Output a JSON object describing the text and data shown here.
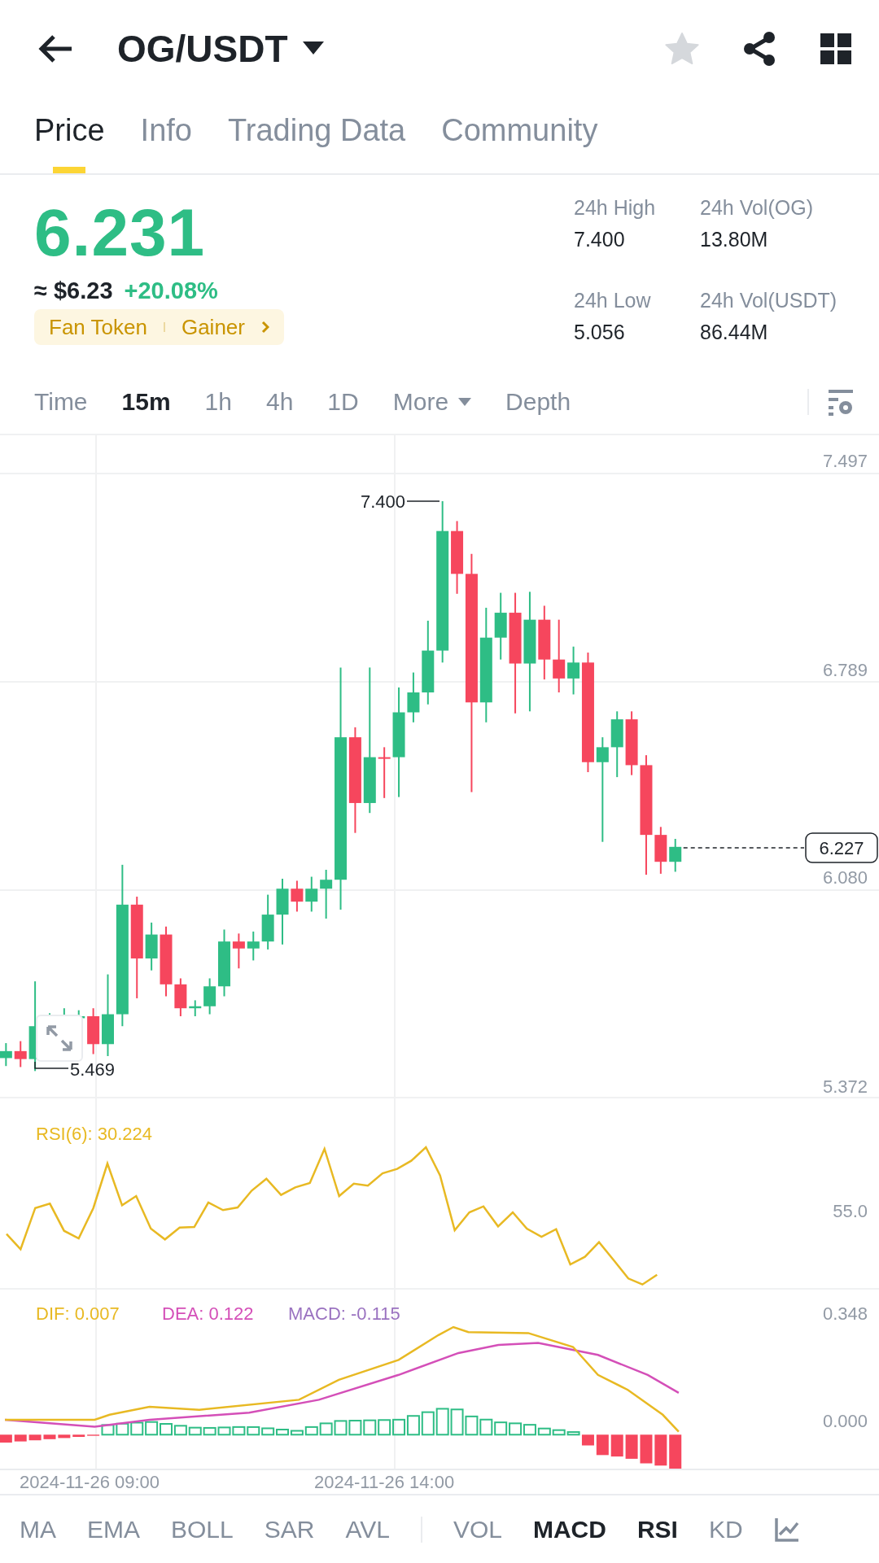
{
  "header": {
    "title": "OG/USDT"
  },
  "tabs": [
    {
      "label": "Price",
      "selected": true
    },
    {
      "label": "Info",
      "selected": false
    },
    {
      "label": "Trading Data",
      "selected": false
    },
    {
      "label": "Community",
      "selected": false
    }
  ],
  "price": {
    "last": "6.231",
    "usd": "≈ $6.23",
    "change": "+20.08%",
    "tags": [
      "Fan Token",
      "Gainer"
    ]
  },
  "stats": [
    {
      "label": "24h High",
      "value": "7.400"
    },
    {
      "label": "24h Vol(OG)",
      "value": "13.80M"
    },
    {
      "label": "24h Low",
      "value": "5.056"
    },
    {
      "label": "24h Vol(USDT)",
      "value": "86.44M"
    }
  ],
  "intervals": [
    {
      "label": "Time",
      "selected": false,
      "kind": "plain"
    },
    {
      "label": "15m",
      "selected": true,
      "kind": "plain"
    },
    {
      "label": "1h",
      "selected": false,
      "kind": "plain"
    },
    {
      "label": "4h",
      "selected": false,
      "kind": "plain"
    },
    {
      "label": "1D",
      "selected": false,
      "kind": "plain"
    },
    {
      "label": "More",
      "selected": false,
      "kind": "dropdown"
    },
    {
      "label": "Depth",
      "selected": false,
      "kind": "plain"
    }
  ],
  "chart": {
    "price_axis": [
      "7.497",
      "6.789",
      "6.080",
      "5.372"
    ],
    "high_marker": "7.400",
    "low_marker": "5.469",
    "last_price_tag": "6.227"
  },
  "rsi": {
    "legend": "RSI(6): 30.224",
    "axis": [
      "55.0"
    ]
  },
  "macd": {
    "legend": [
      {
        "text": "DIF: 0.007",
        "color": "#e8b923"
      },
      {
        "text": "DEA: 0.122",
        "color": "#d44fb8"
      },
      {
        "text": "MACD: -0.115",
        "color": "#9a72c0"
      }
    ],
    "axis": [
      "0.348",
      "0.000"
    ]
  },
  "time_axis": [
    "2024-11-26 09:00",
    "2024-11-26 14:00"
  ],
  "main_indicators": [
    {
      "label": "MA",
      "selected": false
    },
    {
      "label": "EMA",
      "selected": false
    },
    {
      "label": "BOLL",
      "selected": false
    },
    {
      "label": "SAR",
      "selected": false
    },
    {
      "label": "AVL",
      "selected": false
    }
  ],
  "sub_indicators": [
    {
      "label": "VOL",
      "selected": false
    },
    {
      "label": "MACD",
      "selected": true
    },
    {
      "label": "RSI",
      "selected": true
    },
    {
      "label": "KD",
      "selected": false
    }
  ]
}
